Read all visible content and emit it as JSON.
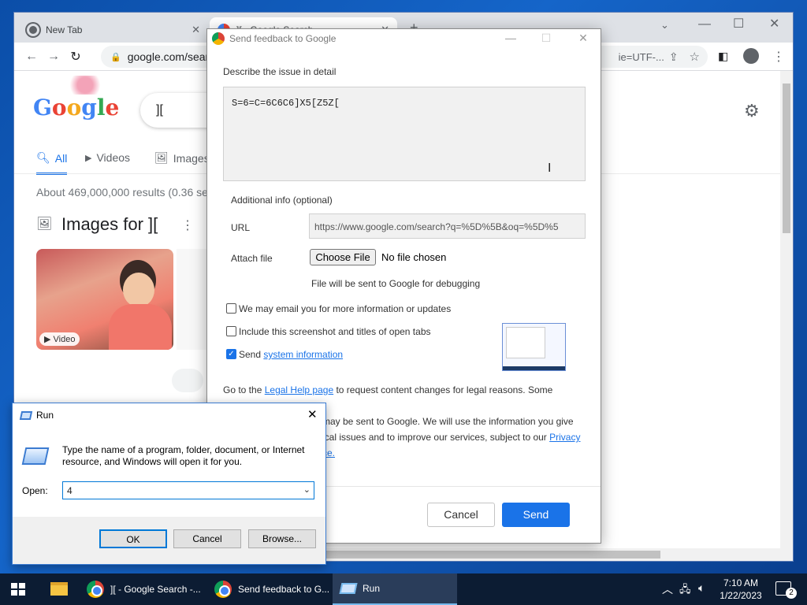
{
  "chrome": {
    "tabs": [
      {
        "label": "New Tab"
      },
      {
        "label": "][ - Google Search"
      }
    ],
    "new_tab_glyph": "+",
    "address": "google.com/search?q=%5D%5B",
    "address_tail": "ie=UTF-...",
    "google_page": {
      "logo": "Google",
      "search_query": "][",
      "tab_all": "All",
      "tab_videos": "Videos",
      "tab_images": "Images",
      "results_stats": "About 469,000,000 results (0.36 se",
      "images_heading": "Images for ][",
      "video_badge": "Video"
    }
  },
  "feedback": {
    "title": "Send feedback to Google",
    "describe_label": "Describe the issue in detail",
    "issue_text": "S=6=C=6C6C6]X5[Z5Z[",
    "additional_info_label": "Additional info (optional)",
    "url_label": "URL",
    "url_value": "https://www.google.com/search?q=%5D%5B&oq=%5D%5",
    "attach_label": "Attach file",
    "choose_file_label": "Choose File",
    "no_file_text": "No file chosen",
    "file_note": "File will be sent to Google for debugging",
    "opt_email": {
      "label": "We may email you for more information or updates",
      "checked": false
    },
    "opt_screenshot": {
      "label": "Include this screenshot and titles of open tabs",
      "checked": false
    },
    "opt_sysinfo": {
      "label": "Send",
      "link": "system information",
      "checked": true
    },
    "legal_prefix": "Go to the",
    "legal_link": "Legal Help page",
    "legal_line1_rest": "to request content changes for legal reasons. Some account",
    "legal_line2": "may be sent to Google. We will use the information you give",
    "legal_line3": "ical issues and to improve our services, subject to our",
    "legal_privacy": "Privacy",
    "legal_line4": "ce.",
    "cancel_label": "Cancel",
    "send_label": "Send"
  },
  "run": {
    "title": "Run",
    "description": "Type the name of a program, folder, document, or Internet resource, and Windows will open it for you.",
    "open_label": "Open:",
    "open_value": "4",
    "ok_label": "OK",
    "cancel_label": "Cancel",
    "browse_label": "Browse..."
  },
  "taskbar": {
    "items": [
      {
        "label": "][ - Google Search -..."
      },
      {
        "label": "Send feedback to G..."
      },
      {
        "label": "Run"
      }
    ],
    "time": "7:10 AM",
    "date": "1/22/2023",
    "notification_count": "2"
  },
  "colors": {
    "accent_blue": "#1a73e8",
    "taskbar": "#0c1c33",
    "desktop": "#1565c9"
  }
}
